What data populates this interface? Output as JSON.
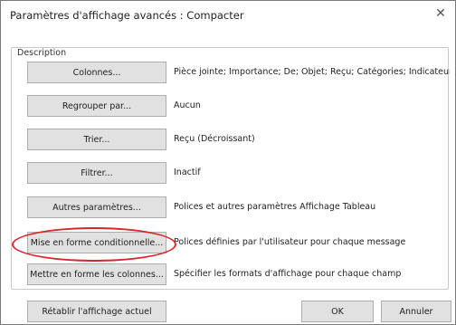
{
  "window": {
    "title": "Paramètres d'affichage avancés : Compacter",
    "close_glyph": "✕"
  },
  "description": {
    "label": "Description",
    "rows": [
      {
        "button": "Colonnes...",
        "value": "Pièce jointe; Importance; De; Objet; Reçu; Catégories; Indicateur ..."
      },
      {
        "button": "Regrouper par...",
        "value": "Aucun"
      },
      {
        "button": "Trier...",
        "value": "Reçu (Décroissant)"
      },
      {
        "button": "Filtrer...",
        "value": "Inactif"
      },
      {
        "button": "Autres paramètres...",
        "value": "Polices et autres paramètres Affichage Tableau"
      },
      {
        "button": "Mise en forme conditionnelle...",
        "value": "Polices définies par l'utilisateur pour chaque message"
      },
      {
        "button": "Mettre en forme les colonnes...",
        "value": "Spécifier les formats d'affichage pour chaque champ"
      }
    ]
  },
  "footer": {
    "reset_label": "Rétablir l'affichage actuel",
    "ok_label": "OK",
    "cancel_label": "Annuler"
  },
  "annotation": {
    "highlight_color": "#d9262c"
  }
}
